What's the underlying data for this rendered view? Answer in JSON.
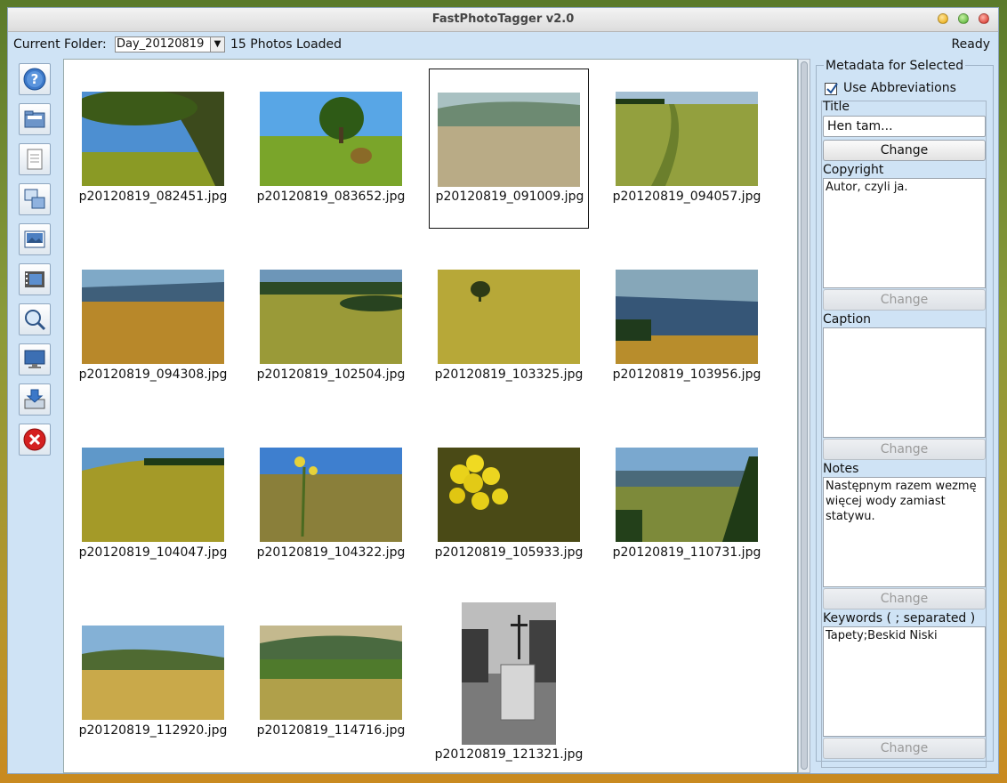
{
  "window": {
    "title": "FastPhotoTagger v2.0"
  },
  "folderbar": {
    "label": "Current Folder:",
    "folder": "Day_20120819",
    "dropdown_arrow": "▼",
    "photos_loaded": "15 Photos Loaded",
    "status": "Ready"
  },
  "toolbar": [
    {
      "icon": "help-icon"
    },
    {
      "icon": "open-folder-icon"
    },
    {
      "icon": "document-icon"
    },
    {
      "icon": "copy-metadata-icon"
    },
    {
      "icon": "image-icon"
    },
    {
      "icon": "film-icon"
    },
    {
      "icon": "zoom-icon"
    },
    {
      "icon": "monitor-icon"
    },
    {
      "icon": "save-icon"
    },
    {
      "icon": "close-icon"
    }
  ],
  "photos": [
    {
      "name": "p20120819_082451.jpg"
    },
    {
      "name": "p20120819_083652.jpg"
    },
    {
      "name": "p20120819_091009.jpg",
      "selected": true
    },
    {
      "name": "p20120819_094057.jpg"
    },
    {
      "name": "p20120819_094308.jpg"
    },
    {
      "name": "p20120819_102504.jpg"
    },
    {
      "name": "p20120819_103325.jpg"
    },
    {
      "name": "p20120819_103956.jpg"
    },
    {
      "name": "p20120819_104047.jpg"
    },
    {
      "name": "p20120819_104322.jpg"
    },
    {
      "name": "p20120819_105933.jpg"
    },
    {
      "name": "p20120819_110731.jpg"
    },
    {
      "name": "p20120819_112920.jpg"
    },
    {
      "name": "p20120819_114716.jpg"
    },
    {
      "name": "p20120819_121321.jpg"
    }
  ],
  "metadata": {
    "legend": "Metadata for Selected",
    "use_abbreviations": "Use Abbreviations",
    "title_label": "Title",
    "title_value": "Hen tam...",
    "change": "Change",
    "copyright_label": "Copyright",
    "copyright_value": "Autor, czyli ja.",
    "caption_label": "Caption",
    "caption_value": "",
    "notes_label": "Notes",
    "notes_value": "Następnym razem wezmę więcej wody zamiast statywu.",
    "keywords_label": "Keywords ( ; separated )",
    "keywords_value": "Tapety;Beskid Niski"
  }
}
